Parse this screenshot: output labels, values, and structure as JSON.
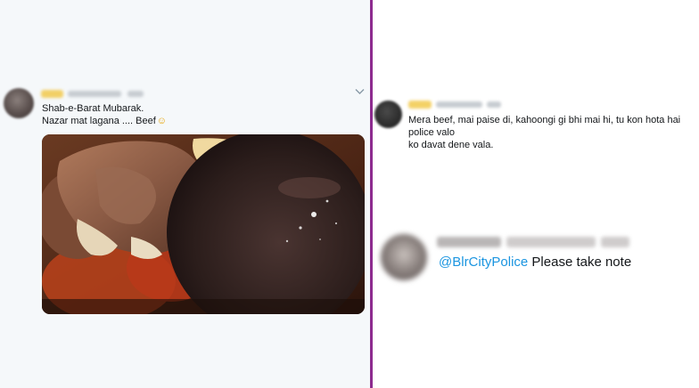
{
  "left_tweet": {
    "text_line1": "Shab-e-Barat Mubarak.",
    "text_line2": "Nazar mat lagana .... Beef",
    "emoji": "☺",
    "menu_icon": "chevron-down-icon",
    "photo_subject": "beef"
  },
  "right_tweet": {
    "text_line1": "Mera beef, mai paise di, kahoongi gi bhi mai hi, tu kon hota hai police valo",
    "text_line2": "ko davat dene vala."
  },
  "reply": {
    "mention": "@BlrCityPolice",
    "text": " Please take note"
  },
  "colors": {
    "divider": "#8d2b8f",
    "mention": "#1b95e0",
    "left_background": "#f5f8fa"
  }
}
